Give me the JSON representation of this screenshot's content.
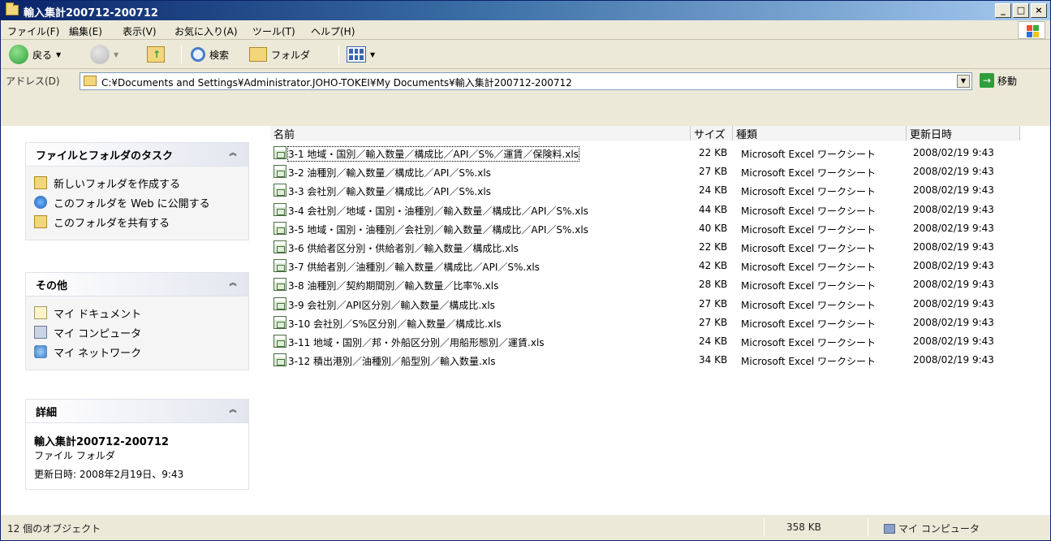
{
  "window": {
    "title": "輸入集計200712-200712",
    "controls": {
      "minimize": "_",
      "maximize": "□",
      "close": "×"
    }
  },
  "menu": {
    "items": [
      "ファイル(F)",
      "編集(E)",
      "表示(V)",
      "お気に入り(A)",
      "ツール(T)",
      "ヘルプ(H)"
    ]
  },
  "toolbar": {
    "back": "戻る",
    "search": "検索",
    "folders": "フォルダ"
  },
  "address": {
    "label": "アドレス(D)",
    "path": "C:¥Documents and Settings¥Administrator.JOHO-TOKEI¥My Documents¥輸入集計200712-200712",
    "go": "移動"
  },
  "tasks": {
    "file_folder_tasks": {
      "title": "ファイルとフォルダのタスク",
      "items": [
        "新しいフォルダを作成する",
        "このフォルダを Web に公開する",
        "このフォルダを共有する"
      ]
    },
    "other_places": {
      "title": "その他",
      "items": [
        "マイ ドキュメント",
        "マイ コンピュータ",
        "マイ ネットワーク"
      ]
    },
    "details": {
      "title": "詳細",
      "name": "輸入集計200712-200712",
      "type": "ファイル フォルダ",
      "modified": "更新日時: 2008年2月19日、9:43"
    }
  },
  "filelist": {
    "columns": [
      "名前",
      "サイズ",
      "種類",
      "更新日時"
    ],
    "rows": [
      {
        "name": "3-1 地域・国別／輸入数量／構成比／API／S%／運賃／保険料.xls",
        "size": "22 KB",
        "type": "Microsoft Excel ワークシート",
        "date": "2008/02/19 9:43"
      },
      {
        "name": "3-2 油種別／輸入数量／構成比／API／S%.xls",
        "size": "27 KB",
        "type": "Microsoft Excel ワークシート",
        "date": "2008/02/19 9:43"
      },
      {
        "name": "3-3 会社別／輸入数量／構成比／API／S%.xls",
        "size": "24 KB",
        "type": "Microsoft Excel ワークシート",
        "date": "2008/02/19 9:43"
      },
      {
        "name": "3-4 会社別／地域・国別・油種別／輸入数量／構成比／API／S%.xls",
        "size": "44 KB",
        "type": "Microsoft Excel ワークシート",
        "date": "2008/02/19 9:43"
      },
      {
        "name": "3-5 地域・国別・油種別／会社別／輸入数量／構成比／API／S%.xls",
        "size": "40 KB",
        "type": "Microsoft Excel ワークシート",
        "date": "2008/02/19 9:43"
      },
      {
        "name": "3-6 供給者区分別・供給者別／輸入数量／構成比.xls",
        "size": "22 KB",
        "type": "Microsoft Excel ワークシート",
        "date": "2008/02/19 9:43"
      },
      {
        "name": "3-7 供給者別／油種別／輸入数量／構成比／API／S%.xls",
        "size": "42 KB",
        "type": "Microsoft Excel ワークシート",
        "date": "2008/02/19 9:43"
      },
      {
        "name": "3-8 油種別／契約期間別／輸入数量／比率%.xls",
        "size": "28 KB",
        "type": "Microsoft Excel ワークシート",
        "date": "2008/02/19 9:43"
      },
      {
        "name": "3-9 会社別／API区分別／輸入数量／構成比.xls",
        "size": "27 KB",
        "type": "Microsoft Excel ワークシート",
        "date": "2008/02/19 9:43"
      },
      {
        "name": "3-10 会社別／S%区分別／輸入数量／構成比.xls",
        "size": "27 KB",
        "type": "Microsoft Excel ワークシート",
        "date": "2008/02/19 9:43"
      },
      {
        "name": "3-11 地域・国別／邦・外船区分別／用船形態別／運賃.xls",
        "size": "24 KB",
        "type": "Microsoft Excel ワークシート",
        "date": "2008/02/19 9:43"
      },
      {
        "name": "3-12 積出港別／油種別／船型別／輸入数量.xls",
        "size": "34 KB",
        "type": "Microsoft Excel ワークシート",
        "date": "2008/02/19 9:43"
      }
    ]
  },
  "status": {
    "objects": "12 個のオブジェクト",
    "total_size": "358 KB",
    "location": "マイ コンピュータ"
  }
}
